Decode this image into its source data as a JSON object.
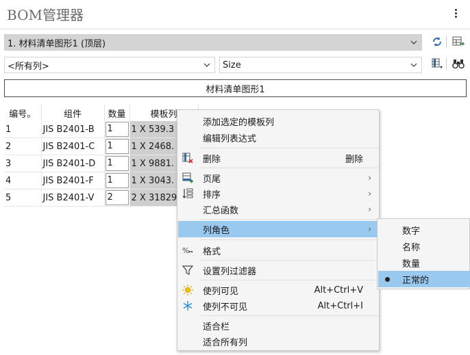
{
  "panel": {
    "title": "BOM管理器"
  },
  "bom_select": {
    "value": "1. 材料清单图形1 (顶层)"
  },
  "column_filter": {
    "value": "<所有列>"
  },
  "size_select": {
    "value": "Size"
  },
  "bom_name": "材料清单图形1",
  "table": {
    "headers": [
      "编号。",
      "组件",
      "数量",
      "模板列"
    ],
    "rows": [
      {
        "no": "1",
        "component": "JIS B2401-B",
        "qty": "1",
        "template": "1 X 539.3"
      },
      {
        "no": "2",
        "component": "JIS B2401-C",
        "qty": "1",
        "template": "1 X 2468."
      },
      {
        "no": "3",
        "component": "JIS B2401-D",
        "qty": "1",
        "template": "1 X 9881."
      },
      {
        "no": "4",
        "component": "JIS B2401-F",
        "qty": "1",
        "template": "1 X 3043."
      },
      {
        "no": "5",
        "component": "JIS B2401-V",
        "qty": "2",
        "template": "2 X 31829"
      }
    ]
  },
  "context_menu": {
    "items": [
      {
        "label": "添加选定的模板列"
      },
      {
        "label": "编辑列表达式"
      },
      {
        "label": "删除",
        "shortcut": "删除",
        "icon": "delete-column-icon"
      },
      {
        "label": "页尾",
        "submenu": true,
        "icon": "footer-icon"
      },
      {
        "label": "排序",
        "submenu": true,
        "icon": "sort-icon"
      },
      {
        "label": "汇总函数",
        "submenu": true
      },
      {
        "label": "列角色",
        "submenu": true,
        "highlighted": true
      },
      {
        "label": "格式",
        "icon": "percent-format-icon"
      },
      {
        "label": "设置列过滤器",
        "icon": "filter-icon"
      },
      {
        "label": "使列可见",
        "shortcut": "Alt+Ctrl+V",
        "icon": "sun-icon"
      },
      {
        "label": "使列不可见",
        "shortcut": "Alt+Ctrl+I",
        "icon": "snowflake-icon"
      },
      {
        "label": "适合栏"
      },
      {
        "label": "适合所有列"
      }
    ],
    "arrow_glyph": "›"
  },
  "submenu": {
    "items": [
      {
        "label": "数字"
      },
      {
        "label": "名称"
      },
      {
        "label": "数量"
      },
      {
        "label": "正常的",
        "selected": true
      }
    ]
  },
  "colors": {
    "highlight": "#99c9ef",
    "template_cell": "#cfcfcf",
    "combo_selected": "#d4d4d4"
  }
}
